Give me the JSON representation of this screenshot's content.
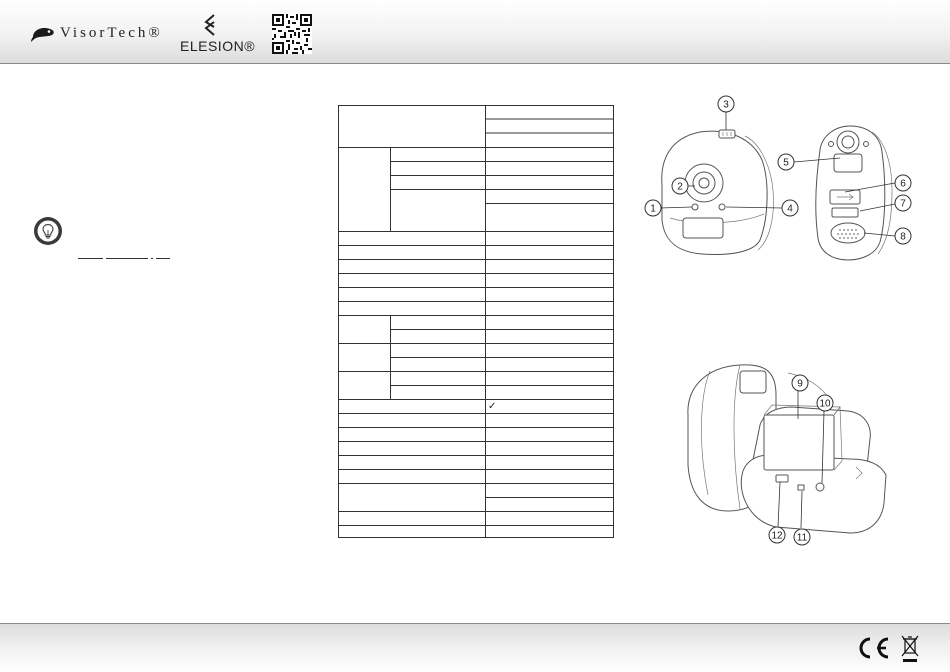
{
  "header": {
    "brand_visortech": "VisorTech®",
    "brand_elesion": "ELESION®",
    "icons": [
      "visortech-logo-icon",
      "elesion-logo-icon",
      "qr-code-icon"
    ]
  },
  "left_column": {
    "icons": [
      "lightbulb-tip-icon"
    ]
  },
  "spec_table": {
    "checkmark": "✓"
  },
  "diagram_front": {
    "callouts": [
      "1",
      "2",
      "3",
      "4",
      "5",
      "6",
      "7",
      "8"
    ]
  },
  "diagram_open": {
    "callouts": [
      "9",
      "10",
      "11",
      "12"
    ]
  },
  "footer": {
    "icons": [
      "ce-mark-icon",
      "weee-bin-icon"
    ]
  },
  "colors": {
    "header_gradient_top": "#ffffff",
    "header_gradient_bottom": "#dcdcdc",
    "rule": "#8a8a8a",
    "line": "#333333"
  }
}
